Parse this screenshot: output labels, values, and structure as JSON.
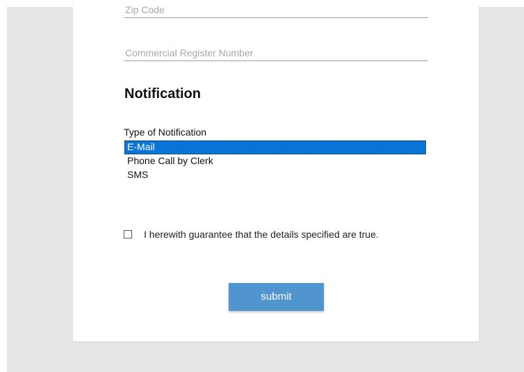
{
  "form": {
    "zip_placeholder": "Zip Code",
    "commercial_register_placeholder": "Commercial Register Number"
  },
  "notification": {
    "heading": "Notification",
    "type_label": "Type of Notification",
    "options": [
      "E-Mail",
      "Phone Call by Clerk",
      "SMS"
    ],
    "selected": "E-Mail"
  },
  "guarantee": {
    "checked": false,
    "label": "I herewith guarantee that the details specified are true."
  },
  "actions": {
    "submit_label": "submit"
  },
  "colors": {
    "accent": "#5094d0",
    "selection": "#0a74d6",
    "page_background": "#e6e6e6"
  }
}
